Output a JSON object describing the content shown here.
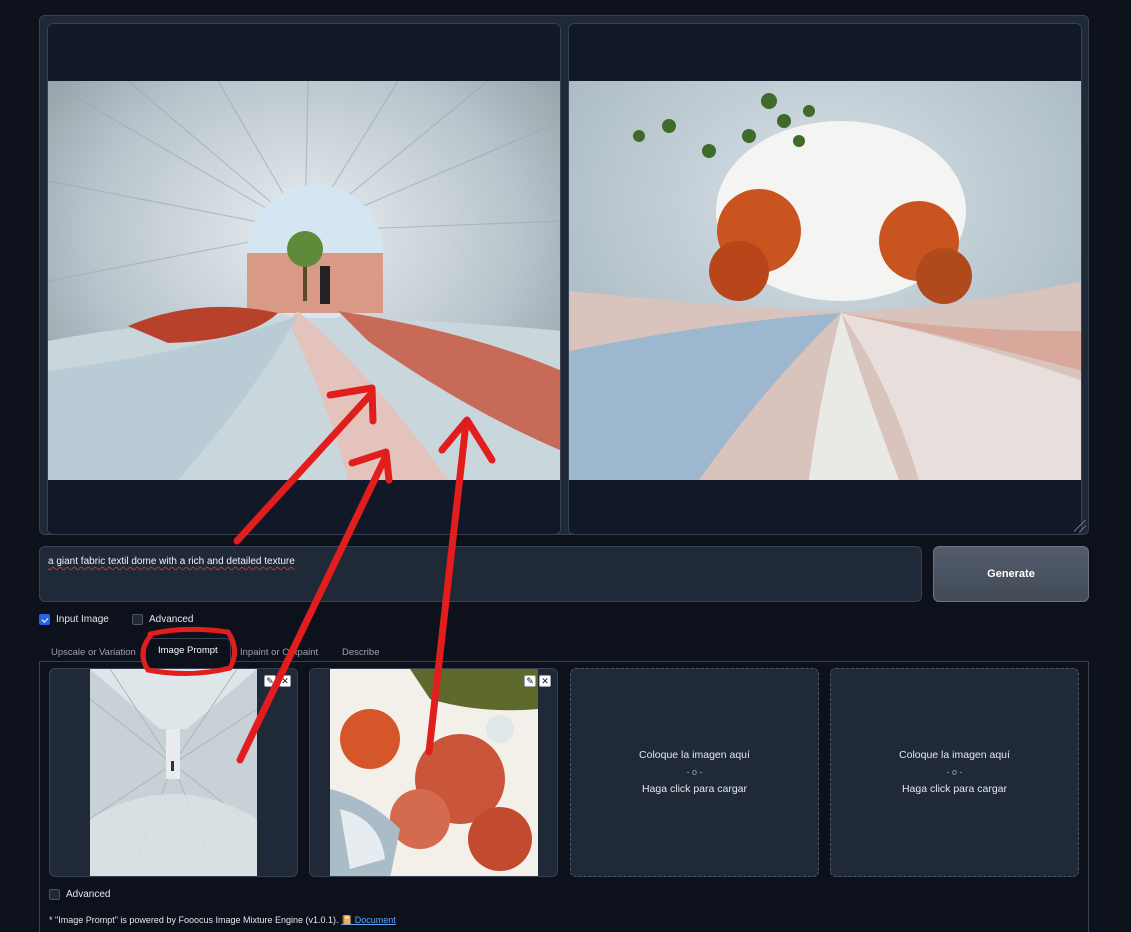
{
  "gallery": {
    "images": [
      {
        "name": "fabric-dome-render-1"
      },
      {
        "name": "fabric-dome-render-2"
      }
    ]
  },
  "prompt": {
    "value": "a giant fabric textil dome with a rich and detailed texture"
  },
  "generate_label": "Generate",
  "options": {
    "input_image_label": "Input Image",
    "input_image_checked": true,
    "advanced_label": "Advanced",
    "advanced_checked": false
  },
  "tabs": [
    {
      "label": "Upscale or Variation",
      "active": false
    },
    {
      "label": "Image Prompt",
      "active": true
    },
    {
      "label": "Inpaint or Outpaint",
      "active": false
    },
    {
      "label": "Describe",
      "active": false
    }
  ],
  "image_prompt": {
    "slot_edit_icon": "pencil-icon",
    "slot_clear_icon": "close-icon",
    "upload": {
      "line1": "Coloque la imagen aquí",
      "line2": "- o -",
      "line3": "Haga click para cargar"
    },
    "advanced_label": "Advanced",
    "footnote_text": "* \"Image Prompt\" is powered by Fooocus Image Mixture Engine (v1.0.1).",
    "doc_link": "📔 Document"
  },
  "annotation_color": "#e11d1d"
}
